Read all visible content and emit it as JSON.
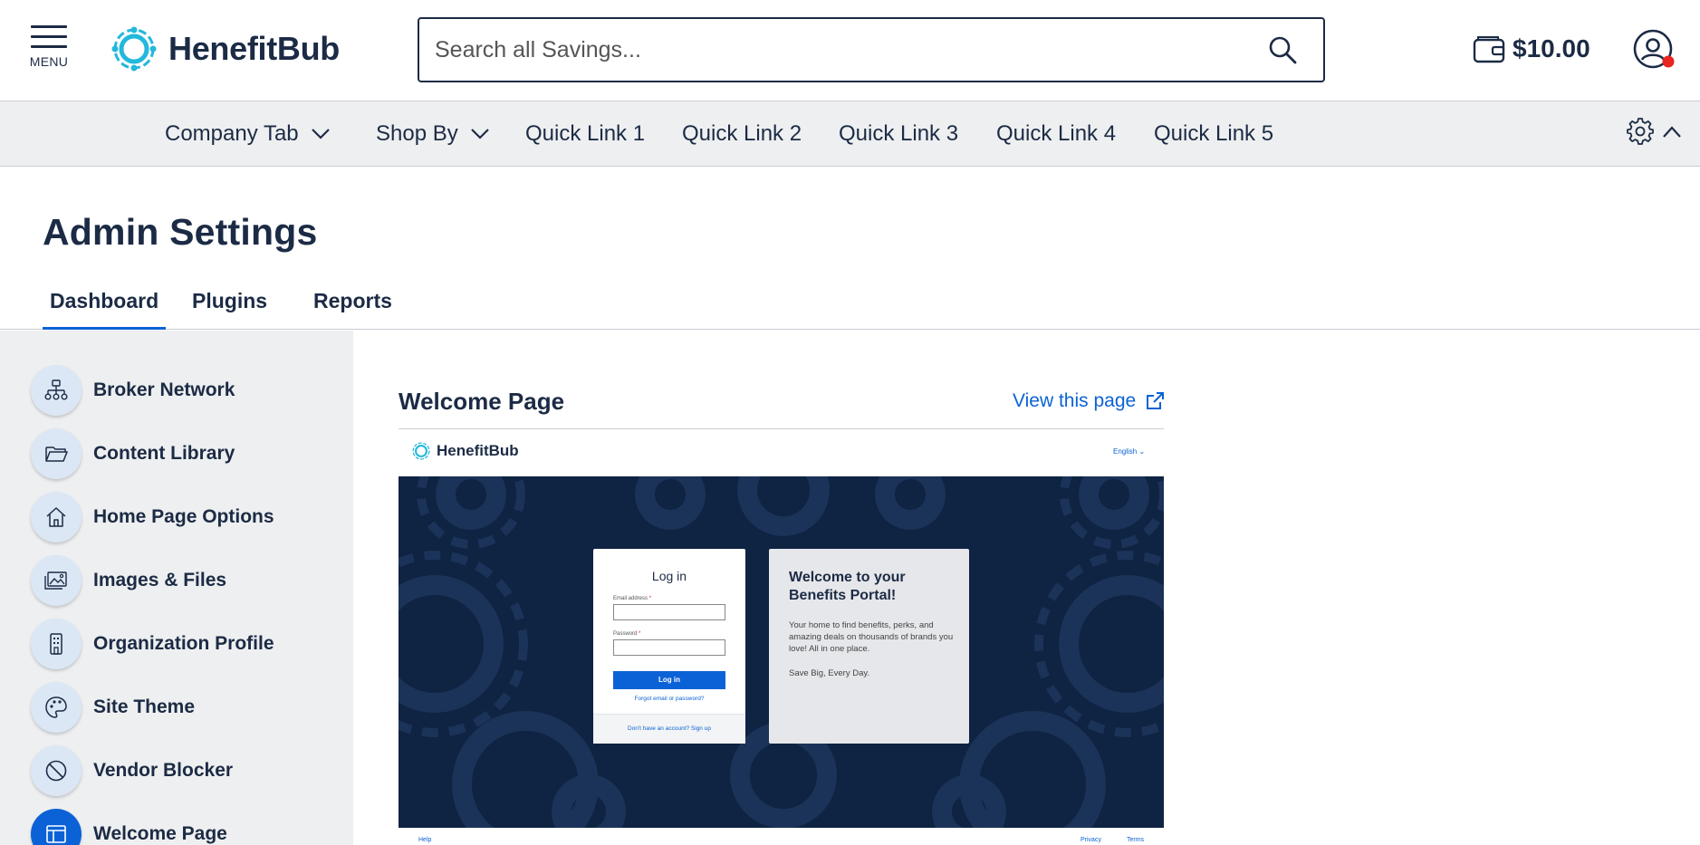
{
  "header": {
    "menu_label": "MENU",
    "logo_text": "HenefitBub",
    "search_placeholder": "Search all Savings...",
    "wallet_amount": "$10.00",
    "notification_color": "#e8261f"
  },
  "nav": {
    "items": [
      {
        "label": "Company Tab",
        "has_dropdown": true
      },
      {
        "label": "Shop By",
        "has_dropdown": true
      },
      {
        "label": "Quick Link 1"
      },
      {
        "label": "Quick Link 2"
      },
      {
        "label": "Quick Link 3"
      },
      {
        "label": "Quick Link 4"
      },
      {
        "label": "Quick Link 5"
      }
    ]
  },
  "page": {
    "title": "Admin Settings",
    "tabs": [
      {
        "label": "Dashboard",
        "active": true
      },
      {
        "label": "Plugins"
      },
      {
        "label": "Reports"
      }
    ]
  },
  "sidebar": {
    "items": [
      {
        "label": "Broker Network",
        "icon": "network-icon"
      },
      {
        "label": "Content Library",
        "icon": "folder-icon"
      },
      {
        "label": "Home Page Options",
        "icon": "home-icon"
      },
      {
        "label": "Images & Files",
        "icon": "image-icon"
      },
      {
        "label": "Organization Profile",
        "icon": "building-icon"
      },
      {
        "label": "Site Theme",
        "icon": "palette-icon"
      },
      {
        "label": "Vendor Blocker",
        "icon": "block-icon"
      },
      {
        "label": "Welcome Page",
        "icon": "layout-icon",
        "active": true
      }
    ]
  },
  "main": {
    "title": "Welcome Page",
    "view_link": "View this page"
  },
  "preview": {
    "logo_text": "HenefitBub",
    "language": "English",
    "login_title": "Log in",
    "email_label": "Email address",
    "password_label": "Password",
    "login_button": "Log in",
    "forgot_link": "Forgot email or password?",
    "signup_text": "Don't have an account? Sign up",
    "welcome_title": "Welcome to your Benefits Portal!",
    "welcome_body": "Your home to find benefits, perks, and amazing deals on thousands of brands you love!  All in one place.",
    "welcome_tagline": "Save Big, Every Day.",
    "footer_help": "Help",
    "footer_privacy": "Privacy",
    "footer_terms": "Terms"
  },
  "colors": {
    "navy": "#1c2b45",
    "accent_blue": "#0b62d6",
    "logo_cyan": "#23b8dc",
    "hero_bg": "#0f2342",
    "nav_bg": "#eeeff0"
  }
}
